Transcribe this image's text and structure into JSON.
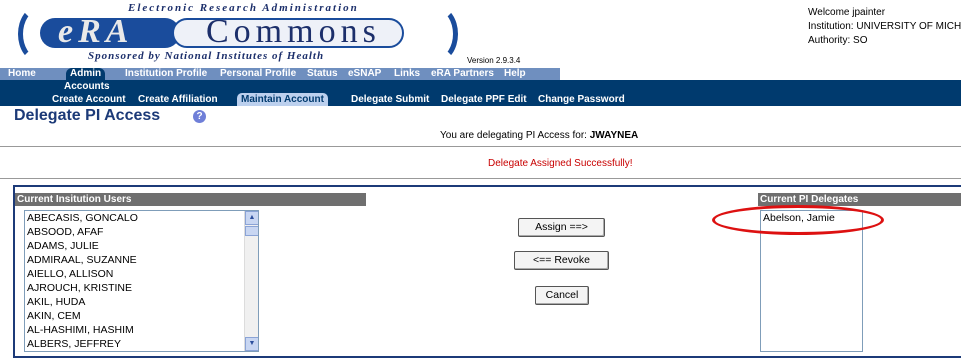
{
  "banner": {
    "top_text": "Electronic Research Administration",
    "era": "eRA",
    "commons": "Commons",
    "sponsor": "Sponsored by National Institutes of Health",
    "version": "Version 2.9.3.4"
  },
  "welcome": {
    "line1": "Welcome jpainter",
    "line2": "Institution: UNIVERSITY OF MICH",
    "line3": "Authority:  SO"
  },
  "nav_primary": [
    "Home",
    "Admin",
    "Institution Profile",
    "Personal Profile",
    "Status",
    "eSNAP",
    "Links",
    "eRA Partners",
    "Help"
  ],
  "nav_secondary": {
    "section": "Accounts",
    "items": [
      "Create Account",
      "Create Affiliation",
      "Maintain Account",
      "Delegate Submit",
      "Delegate PPF Edit",
      "Change Password"
    ]
  },
  "page": {
    "title": "Delegate PI Access",
    "delegating_prefix": "You are delegating PI Access for:",
    "delegating_user": "JWAYNEA",
    "success_message": "Delegate Assigned Successfully!"
  },
  "users": {
    "header": "Current Insitution Users",
    "items": [
      "ABECASIS, GONCALO",
      "ABSOOD, AFAF",
      "ADAMS, JULIE",
      "ADMIRAAL, SUZANNE",
      "AIELLO, ALLISON",
      "AJROUCH, KRISTINE",
      "AKIL, HUDA",
      "AKIN, CEM",
      "AL-HASHIMI, HASHIM",
      "ALBERS, JEFFREY"
    ]
  },
  "buttons": {
    "assign": "Assign ==>",
    "revoke": "<== Revoke",
    "cancel": "Cancel"
  },
  "delegates": {
    "header": "Current PI Delegates",
    "items": [
      "Abelson, Jamie"
    ]
  },
  "colors": {
    "nav_primary_bg": "#6f8fbf",
    "nav_secondary_bg": "#003a6e",
    "title_color": "#1c3a78",
    "success_color": "#c80000",
    "highlight": "#dd1111"
  },
  "icons": {
    "help": "help-icon",
    "scroll_up": "chevron-up-icon",
    "scroll_down": "chevron-down-icon"
  }
}
